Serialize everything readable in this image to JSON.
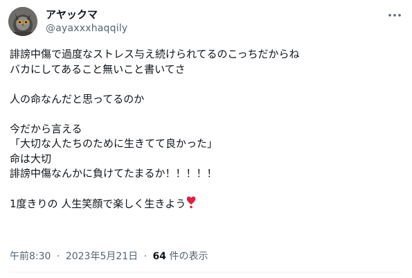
{
  "author": {
    "display_name": "アヤックマ",
    "handle": "@ayaxxxhaqqily",
    "avatar_icon": "owl-photo-avatar"
  },
  "tweet": {
    "lines": [
      "誹謗中傷で過度なストレス与え続けられてるのこっちだからね",
      "バカにしてあること無いこと書いてさ",
      "",
      "人の命なんだと思ってるのか",
      "",
      "今だから言える",
      "「大切な人たちのために生きてて良かった」",
      "命は大切",
      "誹謗中傷なんかに負けてたまるか！！！！！",
      "",
      "1度きりの 人生笑顔で楽しく生きよう"
    ],
    "emoji": "heavy-heart-exclamation-icon"
  },
  "meta": {
    "time": "午前8:30",
    "date": "2023年5月21日",
    "separator": "·",
    "view_count": "64",
    "view_label": " 件の表示"
  },
  "colors": {
    "text": "#0f1419",
    "secondary": "#536471",
    "heart": "#e0203a"
  }
}
